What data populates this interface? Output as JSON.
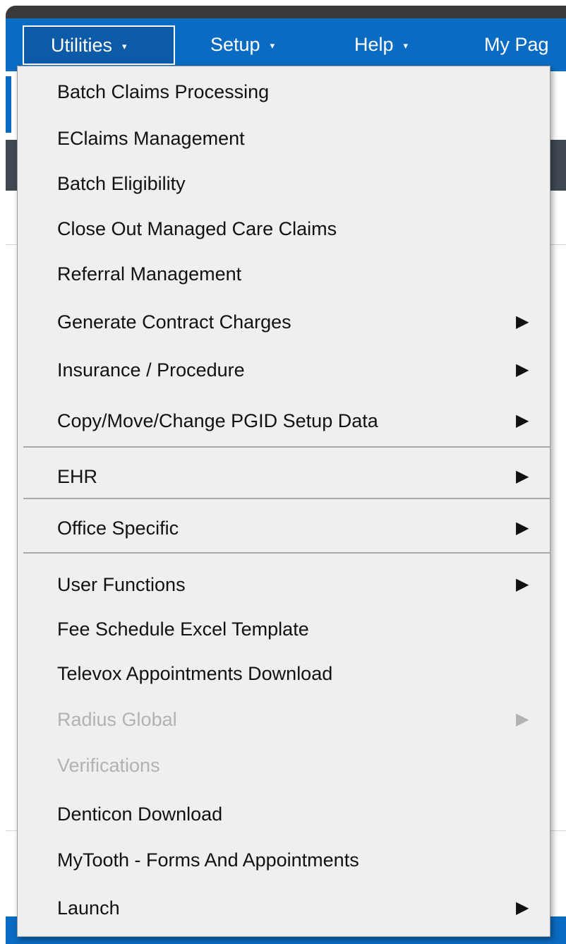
{
  "navbar": {
    "items": [
      {
        "label": "Utilities",
        "caret": "▾"
      },
      {
        "label": "Setup",
        "caret": "▾"
      },
      {
        "label": "Help",
        "caret": "▾"
      },
      {
        "label": "My Pag"
      }
    ]
  },
  "menu": {
    "items": [
      {
        "label": "Batch Claims Processing",
        "arrow": ""
      },
      {
        "label": "EClaims Management",
        "arrow": ""
      },
      {
        "label": "Batch Eligibility",
        "arrow": ""
      },
      {
        "label": "Close Out Managed Care Claims",
        "arrow": ""
      },
      {
        "label": "Referral Management",
        "arrow": ""
      },
      {
        "label": "Generate Contract Charges",
        "arrow": "▶"
      },
      {
        "label": "Insurance / Procedure",
        "arrow": "▶"
      },
      {
        "label": "Copy/Move/Change PGID Setup Data",
        "arrow": "▶"
      },
      {
        "label": "EHR",
        "arrow": "▶"
      },
      {
        "label": "Office Specific",
        "arrow": "▶"
      },
      {
        "label": "User Functions",
        "arrow": "▶"
      },
      {
        "label": "Fee Schedule Excel Template",
        "arrow": ""
      },
      {
        "label": "Televox Appointments Download",
        "arrow": ""
      },
      {
        "label": "Radius Global",
        "arrow": "▶",
        "disabled": true
      },
      {
        "label": "Verifications",
        "arrow": "",
        "disabled": true
      },
      {
        "label": "Denticon Download",
        "arrow": ""
      },
      {
        "label": "MyTooth - Forms And Appointments",
        "arrow": ""
      },
      {
        "label": "Launch",
        "arrow": "▶"
      }
    ]
  },
  "colors": {
    "navbar_blue": "#0a6bc2",
    "menu_bg": "#efefef",
    "disabled_text": "#b2b2b2"
  }
}
